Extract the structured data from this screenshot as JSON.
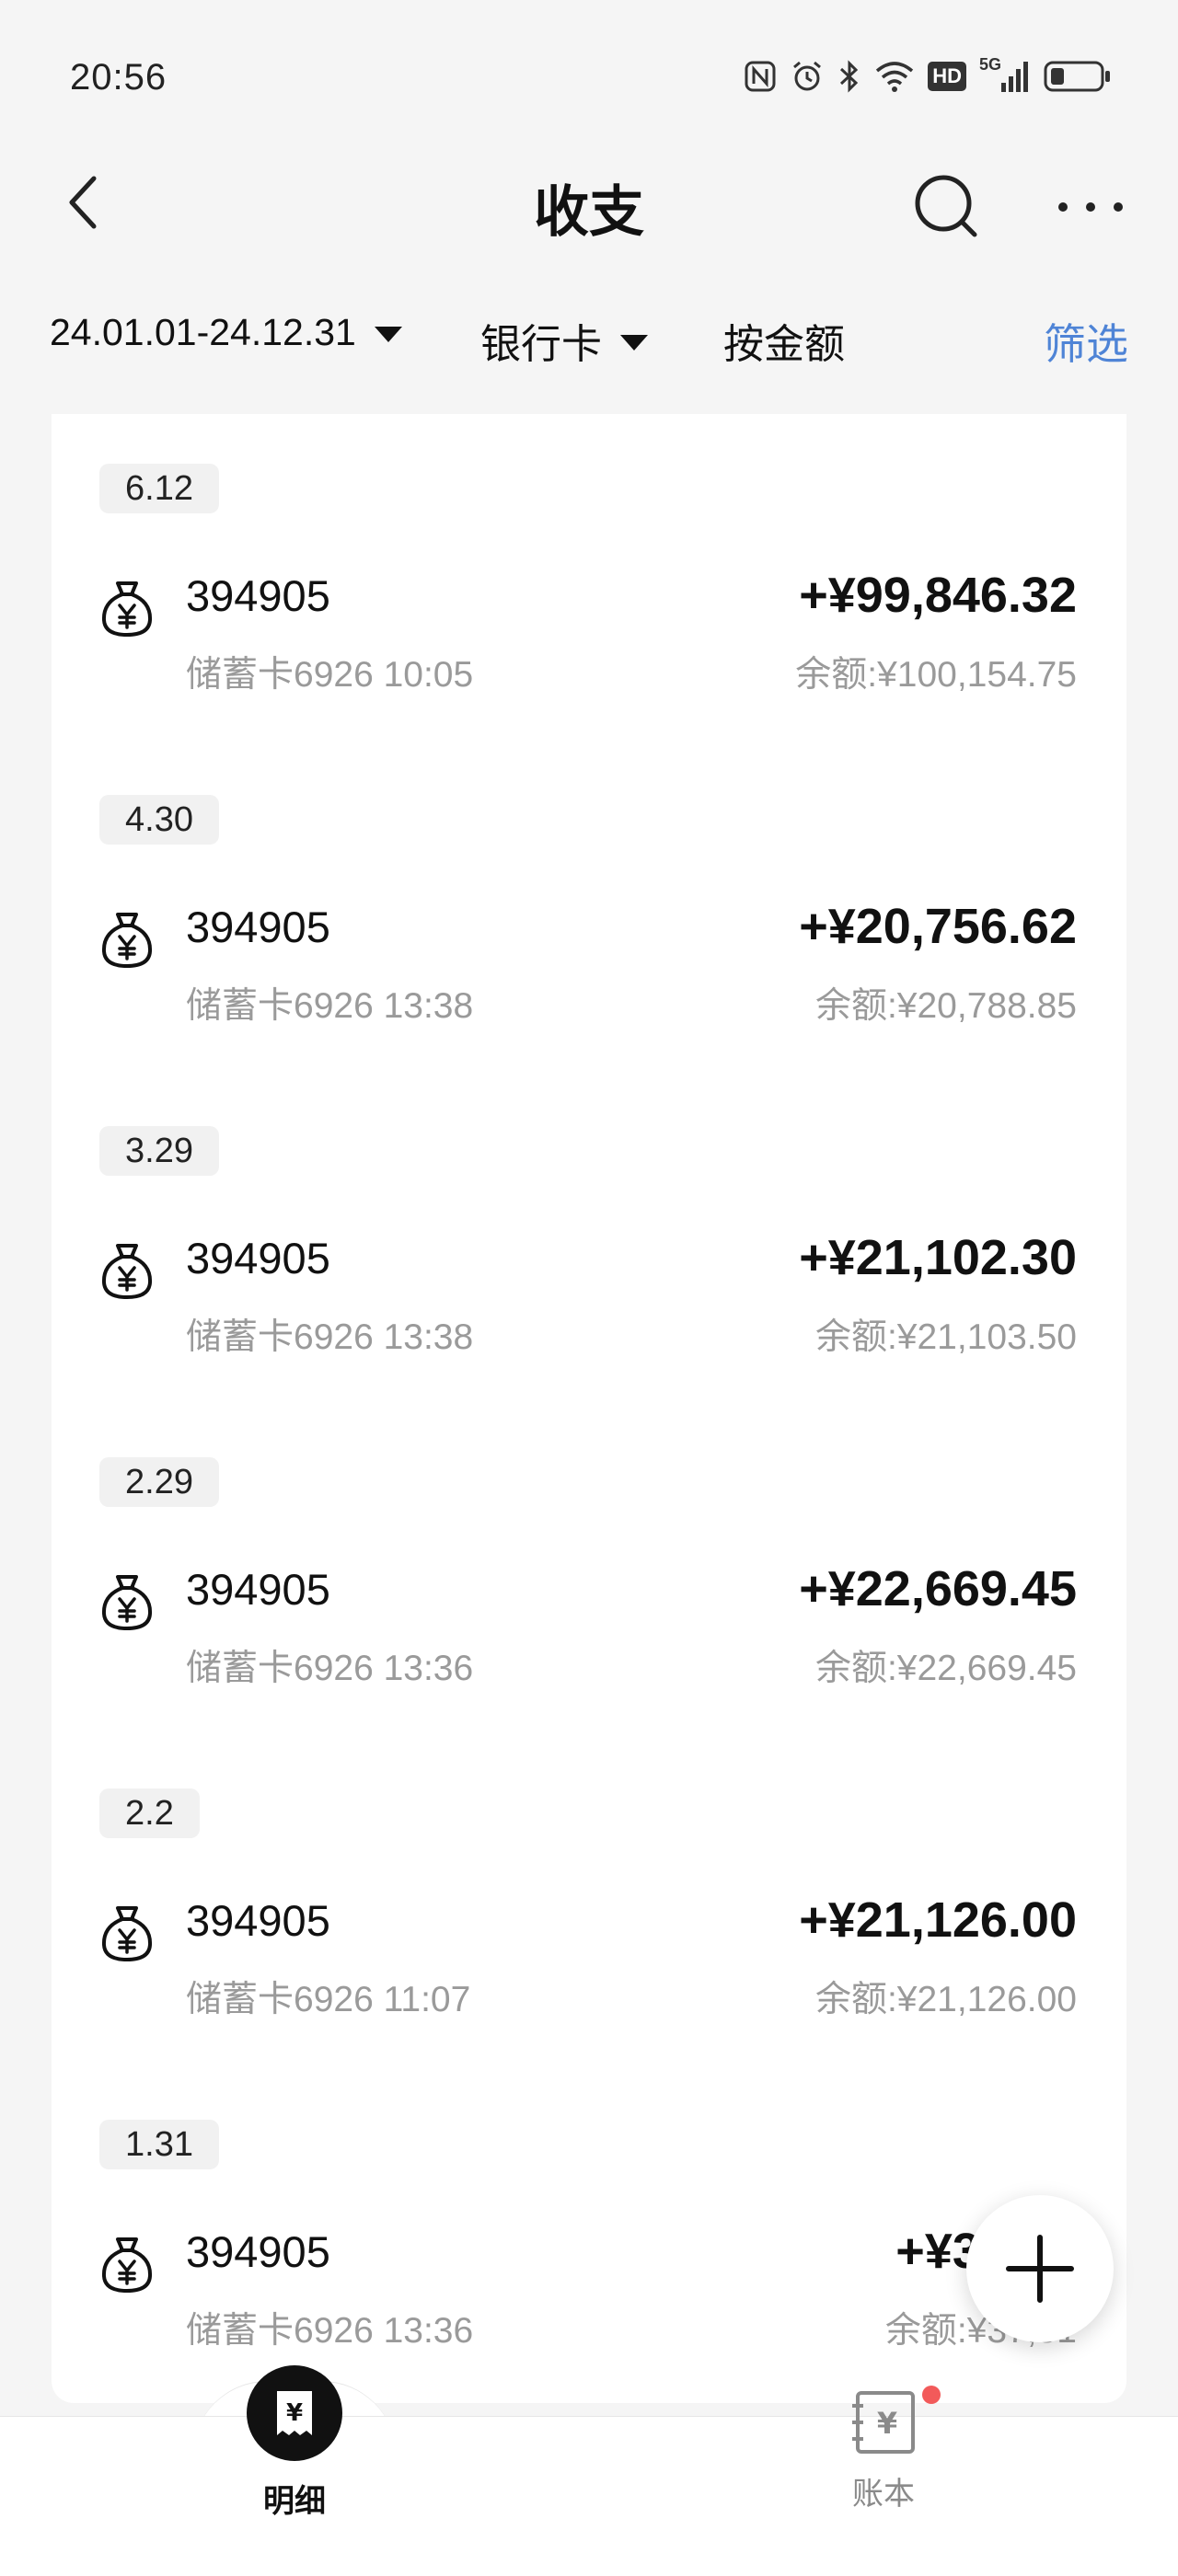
{
  "status_bar": {
    "time": "20:56",
    "icons": [
      "nfc-icon",
      "alarm-icon",
      "bluetooth-icon",
      "wifi-icon",
      "hd-icon",
      "5g-signal-icon",
      "battery-icon"
    ],
    "hd_label": "HD",
    "network_label": "5G"
  },
  "nav": {
    "title": "收支"
  },
  "filters": {
    "date_range": "24.01.01-24.12.31",
    "account": "银行卡",
    "sort": "按金额",
    "screen": "筛选"
  },
  "colors": {
    "accent": "#4f84d6",
    "badge": "#f25a5a",
    "secondary_text": "#9a9a9a"
  },
  "transactions": [
    {
      "date": "6.12",
      "name": "394905",
      "sub": "储蓄卡6926 10:05",
      "amount": "+¥99,846.32",
      "balance": "余额:¥100,154.75"
    },
    {
      "date": "4.30",
      "name": "394905",
      "sub": "储蓄卡6926 13:38",
      "amount": "+¥20,756.62",
      "balance": "余额:¥20,788.85"
    },
    {
      "date": "3.29",
      "name": "394905",
      "sub": "储蓄卡6926 13:38",
      "amount": "+¥21,102.30",
      "balance": "余额:¥21,103.50"
    },
    {
      "date": "2.29",
      "name": "394905",
      "sub": "储蓄卡6926 13:36",
      "amount": "+¥22,669.45",
      "balance": "余额:¥22,669.45"
    },
    {
      "date": "2.2",
      "name": "394905",
      "sub": "储蓄卡6926 11:07",
      "amount": "+¥21,126.00",
      "balance": "余额:¥21,126.00"
    },
    {
      "date": "1.31",
      "name": "394905",
      "sub": "储蓄卡6926 13:36",
      "amount": "+¥37,51",
      "balance": "余额:¥37,51"
    }
  ],
  "bottom_nav": {
    "detail_label": "明细",
    "book_label": "账本",
    "detail_glyph": "¥",
    "book_glyph": "¥"
  }
}
